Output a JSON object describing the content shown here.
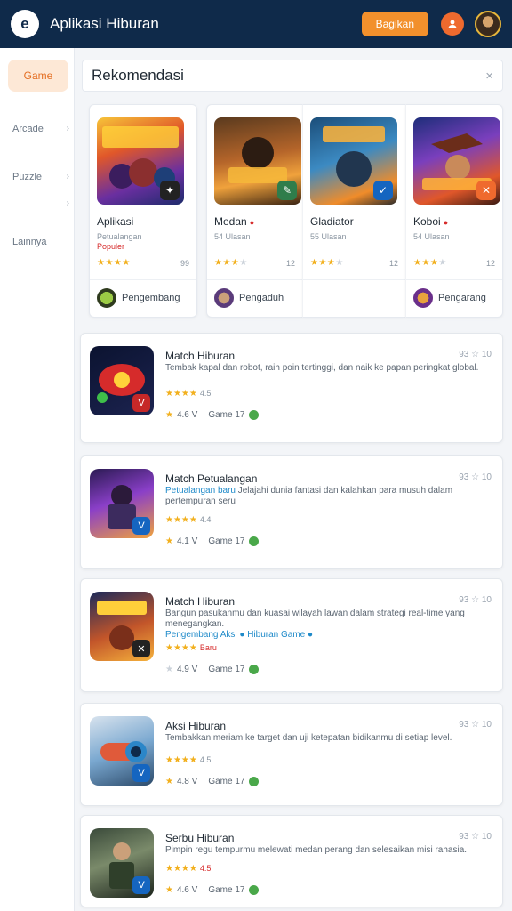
{
  "header": {
    "logo_glyph": "e",
    "title": "Aplikasi Hiburan",
    "button_label": "Bagikan",
    "user_icon": "user-icon",
    "colors": {
      "bar": "#0f2a4a",
      "accent": "#f2902c"
    }
  },
  "sidebar": {
    "active_label": "Game",
    "items": [
      {
        "label": "Arcade",
        "chevron": "›"
      },
      {
        "label": "Puzzle",
        "chevron": "›"
      },
      {
        "label": "",
        "chevron": "›"
      },
      {
        "label": "Lainnya",
        "chevron": ""
      }
    ]
  },
  "search": {
    "title": "Rekomendasi",
    "close_glyph": "×"
  },
  "featured": [
    {
      "name": "Aplikasi",
      "dot": "",
      "meta": "Petualangan",
      "sub": "Populer",
      "stars_on": 4,
      "stars_off": 0,
      "count": "99",
      "developer": "Pengembang",
      "badge": "✦",
      "badge_color": "#222",
      "art_title": "SUNGAI"
    },
    {
      "name": "Medan",
      "dot": "●",
      "meta": "54 Ulasan",
      "sub": "",
      "stars_on": 3,
      "stars_off": 1,
      "count": "12",
      "developer": "Pengaduh",
      "badge": "✎",
      "badge_color": "#2f7d4b",
      "art_title": "BERTEMPUR"
    },
    {
      "name": "Gladiator",
      "dot": "",
      "meta": "55 Ulasan",
      "sub": "",
      "stars_on": 3,
      "stars_off": 1,
      "count": "12",
      "developer": "",
      "badge": "✓",
      "badge_color": "#1565c0",
      "art_title": "PAHLAWAN"
    },
    {
      "name": "Koboi",
      "dot": "●",
      "meta": "54 Ulasan",
      "sub": "",
      "stars_on": 3,
      "stars_off": 1,
      "count": "12",
      "developer": "Pengarang",
      "badge": "✕",
      "badge_color": "#ef6a2e",
      "art_title": "PEMBURU"
    }
  ],
  "list": [
    {
      "title": "Match Hiburan",
      "meta": "93 ☆ 10",
      "desc": "Tembak kapal dan robot, raih poin tertinggi, dan naik ke papan peringkat global.",
      "desc_blue": "",
      "stars_on": 4,
      "stars_off": 0,
      "rating_num": "4.5",
      "rating_red": false,
      "foot_rating": "4.6 V",
      "foot_cat": "Game 17",
      "foot_star_grey": false,
      "badge": "V",
      "badge_color": "#c62828"
    },
    {
      "title": "Match Petualangan",
      "meta": "93 ☆ 10",
      "desc": "Jelajahi dunia fantasi dan kalahkan para musuh dalam pertempuran seru",
      "desc_blue": "Petualangan baru",
      "stars_on": 4,
      "stars_off": 0,
      "rating_num": "4.4",
      "rating_red": false,
      "foot_rating": "4.1 V",
      "foot_cat": "Game 17",
      "foot_star_grey": false,
      "badge": "V",
      "badge_color": "#1565c0"
    },
    {
      "title": "Match Hiburan",
      "meta": "93 ☆ 10",
      "desc": "Bangun pasukanmu dan kuasai wilayah lawan dalam strategi real-time yang menegangkan.",
      "desc_blue": "Pengembang Aksi ● Hiburan Game ●",
      "stars_on": 4,
      "stars_off": 0,
      "rating_num": "Baru",
      "rating_red": true,
      "foot_rating": "4.9 V",
      "foot_cat": "Game 17",
      "foot_star_grey": true,
      "badge": "✕",
      "badge_color": "#222"
    },
    {
      "title": "Aksi Hiburan",
      "meta": "93 ☆ 10",
      "desc": "Tembakkan meriam ke target dan uji ketepatan bidikanmu di setiap level.",
      "desc_blue": "",
      "stars_on": 4,
      "stars_off": 0,
      "rating_num": "4.5",
      "rating_red": false,
      "foot_rating": "4.8 V",
      "foot_cat": "Game 17",
      "foot_star_grey": false,
      "badge": "V",
      "badge_color": "#1565c0"
    },
    {
      "title": "Serbu Hiburan",
      "meta": "93 ☆ 10",
      "desc": "Pimpin regu tempurmu melewati medan perang dan selesaikan misi rahasia.",
      "desc_blue": "",
      "stars_on": 4,
      "stars_off": 0,
      "rating_num": "4.5",
      "rating_red": true,
      "foot_rating": "4.6 V",
      "foot_cat": "Game 17",
      "foot_star_grey": false,
      "badge": "V",
      "badge_color": "#1565c0"
    }
  ]
}
